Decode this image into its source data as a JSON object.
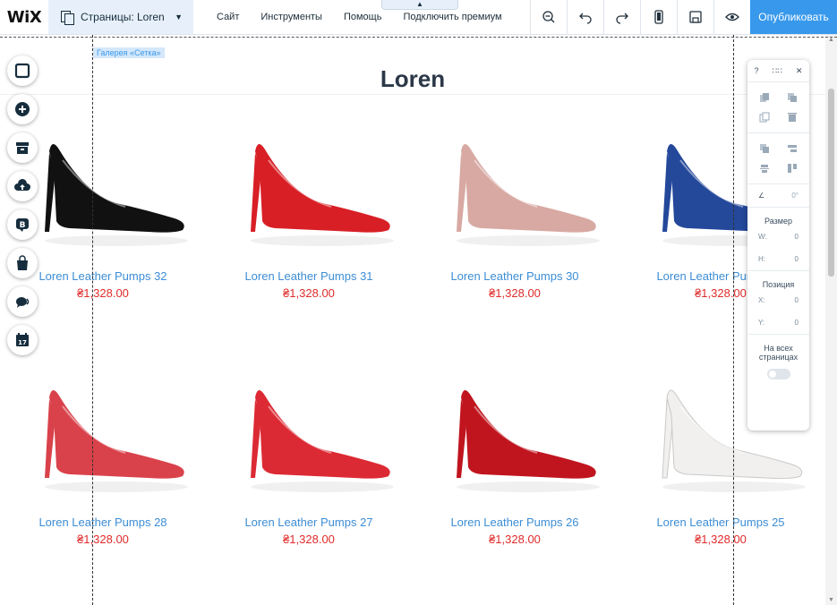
{
  "topbar": {
    "logo": "WiX",
    "pages_label": "Страницы: Loren",
    "menu": [
      "Сайт",
      "Инструменты",
      "Помощь",
      "Подключить премиум"
    ],
    "publish_label": "Опубликовать",
    "tool_icons": [
      "zoom-out-icon",
      "undo-icon",
      "redo-icon",
      "mobile-icon",
      "save-icon",
      "preview-icon"
    ]
  },
  "canvas": {
    "page_title": "Loren",
    "gallery_tag": "Галерея «Сетка»"
  },
  "products": [
    {
      "name": "Loren Leather Pumps 32",
      "price": "₴1,328.00",
      "color": "#111111"
    },
    {
      "name": "Loren Leather Pumps 31",
      "price": "₴1,328.00",
      "color": "#d81f26"
    },
    {
      "name": "Loren Leather Pumps 30",
      "price": "₴1,328.00",
      "color": "#d7a9a2"
    },
    {
      "name": "Loren Leather Pumps 29",
      "price": "₴1,328.00",
      "color": "#24489a"
    },
    {
      "name": "Loren Leather Pumps 28",
      "price": "₴1,328.00",
      "color": "#d9424b"
    },
    {
      "name": "Loren Leather Pumps 27",
      "price": "₴1,328.00",
      "color": "#dc2a34"
    },
    {
      "name": "Loren Leather Pumps 26",
      "price": "₴1,328.00",
      "color": "#c0151f"
    },
    {
      "name": "Loren Leather Pumps 25",
      "price": "₴1,328.00",
      "color": "#f1f0ee"
    }
  ],
  "left_tools": [
    "background-icon",
    "add-icon",
    "store-icon",
    "upload-icon",
    "blog-icon",
    "shop-bag-icon",
    "chat-icon",
    "bookings-icon"
  ],
  "panel": {
    "help": "?",
    "size_label": "Размер",
    "w_label": "W:",
    "h_label": "H:",
    "w_value": "0",
    "h_value": "0",
    "position_label": "Позиция",
    "x_label": "X:",
    "y_label": "Y:",
    "x_value": "0",
    "y_value": "0",
    "rotation_value": "0°",
    "all_pages_label": "На всех страницах"
  },
  "colors": {
    "accent": "#3899ec",
    "price": "#e02b2b",
    "product_name": "#3c8dd5"
  }
}
